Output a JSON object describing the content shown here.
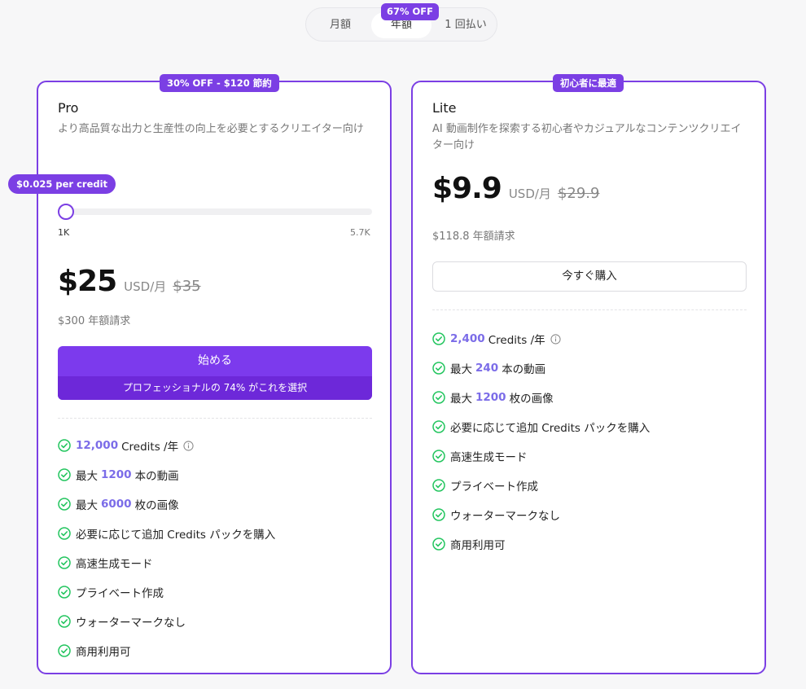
{
  "billing_toggle": {
    "monthly": "月額",
    "yearly": "年額",
    "one_time": "1 回払い",
    "discount_badge": "67% OFF"
  },
  "colors": {
    "accent": "#7b3fe4",
    "check": "#22c55e",
    "highlight": "#7b6ce8"
  },
  "pro": {
    "badge": "30% OFF - $120 節約",
    "name": "Pro",
    "description": "より高品質な出力と生産性の向上を必要とするクリエイター向け",
    "credit_tip": "$0.025 per credit",
    "slider_min": "1K",
    "slider_max": "5.7K",
    "slider_position": 0,
    "price": "$25",
    "unit": "USD/月",
    "old_price": "$35",
    "billed": "$300 年額請求",
    "cta": "始める",
    "cta_sub": "プロフェッショナルの 74% がこれを選択",
    "features": {
      "credits_value": "12,000",
      "credits_text": "Credits /年",
      "videos_prefix": "最大",
      "videos_value": "1200",
      "videos_suffix": "本の動画",
      "images_prefix": "最大",
      "images_value": "6000",
      "images_suffix": "枚の画像",
      "f4": "必要に応じて追加 Credits パックを購入",
      "f5": "高速生成モード",
      "f6": "プライベート作成",
      "f7": "ウォーターマークなし",
      "f8": "商用利用可"
    }
  },
  "lite": {
    "badge": "初心者に最適",
    "name": "Lite",
    "description": "AI 動画制作を探索する初心者やカジュアルなコンテンツクリエイター向け",
    "price": "$9.9",
    "unit": "USD/月",
    "old_price": "$29.9",
    "billed": "$118.8 年額請求",
    "cta": "今すぐ購入",
    "features": {
      "credits_value": "2,400",
      "credits_text": "Credits /年",
      "videos_prefix": "最大",
      "videos_value": "240",
      "videos_suffix": "本の動画",
      "images_prefix": "最大",
      "images_value": "1200",
      "images_suffix": "枚の画像",
      "f4": "必要に応じて追加 Credits パックを購入",
      "f5": "高速生成モード",
      "f6": "プライベート作成",
      "f7": "ウォーターマークなし",
      "f8": "商用利用可"
    }
  }
}
